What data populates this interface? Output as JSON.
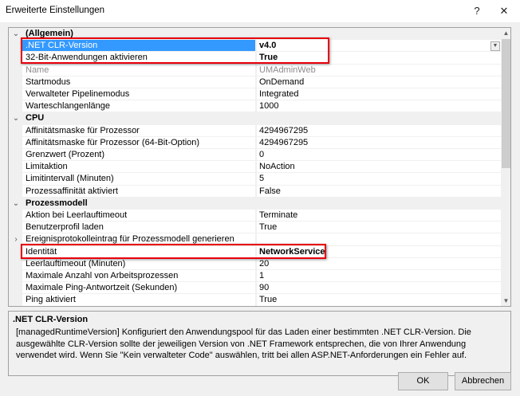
{
  "window": {
    "title": "Erweiterte Einstellungen",
    "help": "?",
    "close": "✕"
  },
  "grid": {
    "rows": [
      {
        "type": "cat",
        "label": "(Allgemein)"
      },
      {
        "label": ".NET CLR-Version",
        "value": "v4.0",
        "selected": true,
        "bold": true,
        "dropdown": true
      },
      {
        "label": "32-Bit-Anwendungen aktivieren",
        "value": "True",
        "bold": true
      },
      {
        "label": "Name",
        "value": "UMAdminWeb",
        "disabled": true
      },
      {
        "label": "Startmodus",
        "value": "OnDemand"
      },
      {
        "label": "Verwalteter Pipelinemodus",
        "value": "Integrated"
      },
      {
        "label": "Warteschlangenlänge",
        "value": "1000"
      },
      {
        "type": "cat",
        "label": "CPU"
      },
      {
        "label": "Affinitätsmaske für Prozessor",
        "value": "4294967295"
      },
      {
        "label": "Affinitätsmaske für Prozessor (64-Bit-Option)",
        "value": "4294967295"
      },
      {
        "label": "Grenzwert (Prozent)",
        "value": "0"
      },
      {
        "label": "Limitaktion",
        "value": "NoAction"
      },
      {
        "label": "Limitintervall (Minuten)",
        "value": "5"
      },
      {
        "label": "Prozessaffinität aktiviert",
        "value": "False"
      },
      {
        "type": "cat",
        "label": "Prozessmodell"
      },
      {
        "label": "Aktion bei Leerlauftimeout",
        "value": "Terminate"
      },
      {
        "label": "Benutzerprofil laden",
        "value": "True"
      },
      {
        "label": "Ereignisprotokolleintrag für Prozessmodell generieren",
        "value": "",
        "expandable": true
      },
      {
        "label": "Identität",
        "value": "NetworkService",
        "bold": true
      },
      {
        "label": "Leerlauftimeout (Minuten)",
        "value": "20"
      },
      {
        "label": "Maximale Anzahl von Arbeitsprozessen",
        "value": "1"
      },
      {
        "label": "Maximale Ping-Antwortzeit (Sekunden)",
        "value": "90"
      },
      {
        "label": "Ping aktiviert",
        "value": "True"
      }
    ]
  },
  "description": {
    "title": ".NET CLR-Version",
    "text": "[managedRuntimeVersion] Konfiguriert den Anwendungspool für das Laden einer bestimmten .NET CLR-Version. Die ausgewählte CLR-Version sollte der jeweiligen Version von .NET Framework entsprechen, die von Ihrer Anwendung verwendet wird. Wenn Sie \"Kein verwalteter Code\" auswählen, tritt bei allen ASP.NET-Anforderungen ein Fehler auf."
  },
  "buttons": {
    "ok": "OK",
    "cancel": "Abbrechen"
  },
  "colors": {
    "selection": "#3399ff",
    "highlight": "#e8000b"
  }
}
